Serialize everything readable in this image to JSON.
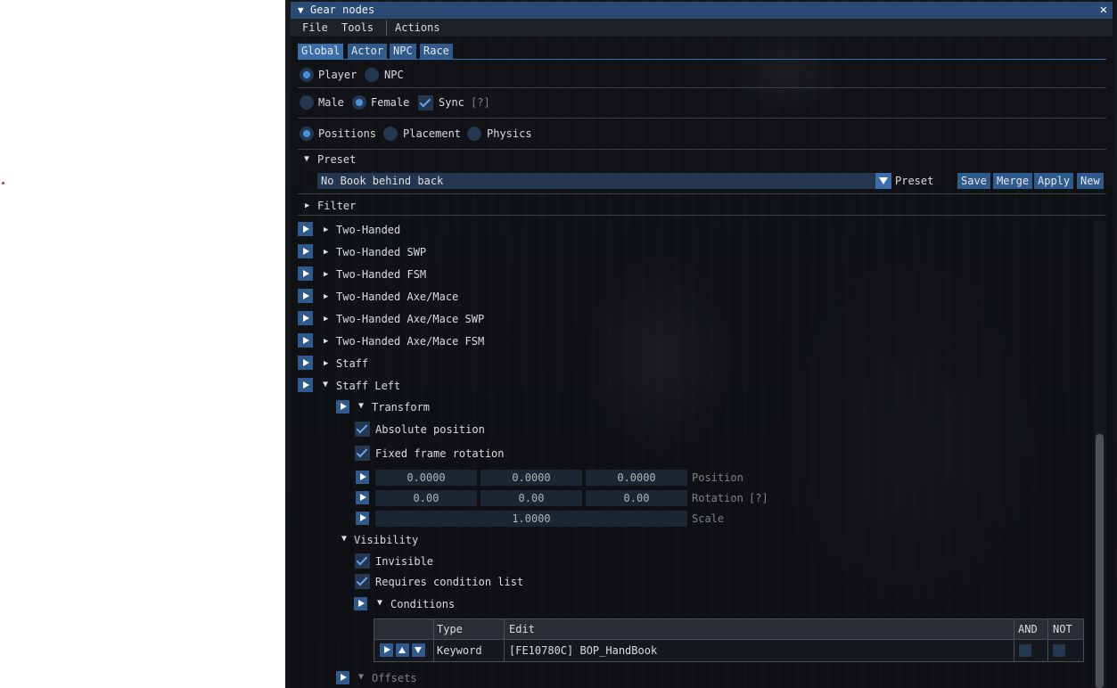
{
  "window": {
    "title": "Gear nodes",
    "close_glyph": "✕"
  },
  "menu": [
    "File",
    "Tools",
    "Actions"
  ],
  "tabs": [
    "Global",
    "Actor",
    "NPC",
    "Race"
  ],
  "target": {
    "player": "Player",
    "npc": "NPC",
    "selected": "Player"
  },
  "sex": {
    "male": "Male",
    "female": "Female",
    "selected": "Female",
    "sync_label": "Sync",
    "sync_checked": true,
    "help": "[?]"
  },
  "mode": {
    "positions": "Positions",
    "placement": "Placement",
    "physics": "Physics",
    "selected": "Positions"
  },
  "preset": {
    "header": "Preset",
    "value": "No Book behind back",
    "label": "Preset",
    "buttons": {
      "save": "Save",
      "merge": "Merge",
      "apply": "Apply",
      "new": "New"
    }
  },
  "filter": {
    "header": "Filter"
  },
  "nodes": [
    "Two-Handed",
    "Two-Handed SWP",
    "Two-Handed FSM",
    "Two-Handed Axe/Mace",
    "Two-Handed Axe/Mace SWP",
    "Two-Handed Axe/Mace FSM",
    "Staff",
    "Staff Left"
  ],
  "transform": {
    "header": "Transform",
    "absolute_position": "Absolute position",
    "absolute_position_checked": true,
    "fixed_frame_rotation": "Fixed frame rotation",
    "fixed_frame_rotation_checked": true,
    "position": {
      "label": "Position",
      "x": "0.0000",
      "y": "0.0000",
      "z": "0.0000"
    },
    "rotation": {
      "label": "Rotation",
      "help": "[?]",
      "x": "0.00",
      "y": "0.00",
      "z": "0.00"
    },
    "scale": {
      "label": "Scale",
      "value": "1.0000"
    }
  },
  "visibility": {
    "header": "Visibility",
    "invisible": "Invisible",
    "invisible_checked": true,
    "requires_condition_list": "Requires condition list",
    "requires_condition_list_checked": true,
    "conditions": {
      "header": "Conditions",
      "columns": {
        "type": "Type",
        "edit": "Edit",
        "and": "AND",
        "not": "NOT"
      },
      "rows": [
        {
          "type": "Keyword",
          "edit": "[FE10780C] BOP_HandBook",
          "and": false,
          "not": false
        }
      ]
    }
  },
  "offsets": {
    "header": "Offsets"
  },
  "colors": {
    "accent": "#2e5a8e",
    "title_bar": "#2a4a73",
    "check": "#6aa6ee"
  }
}
